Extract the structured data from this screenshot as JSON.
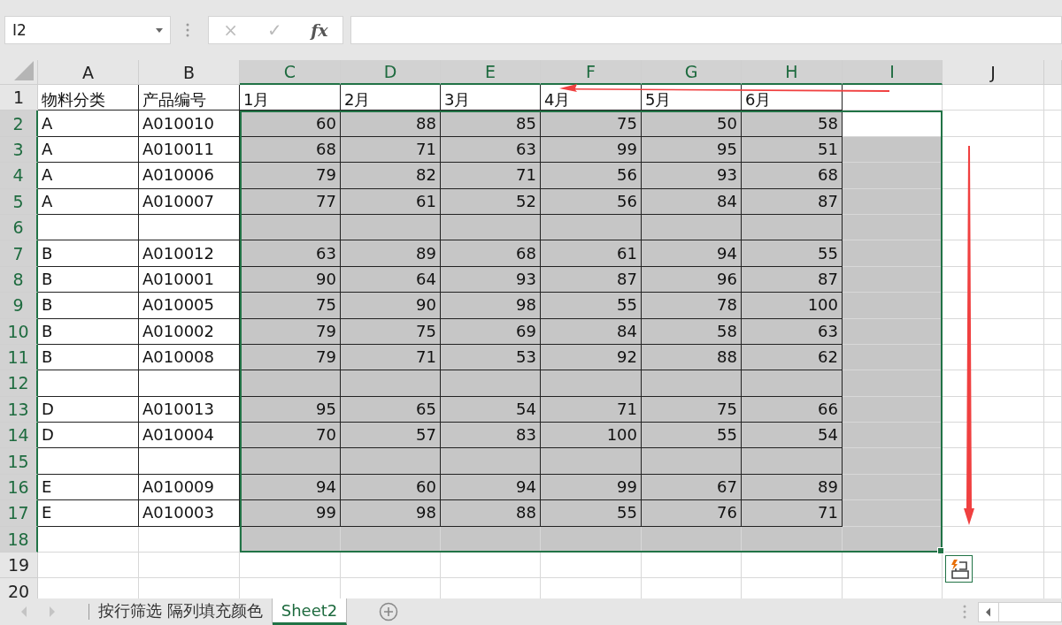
{
  "name_box": {
    "value": "I2"
  },
  "formula_bar": {
    "cancel": "×",
    "enter": "✓",
    "function": "fx"
  },
  "columns": [
    {
      "letter": "A",
      "selected": false,
      "active": false
    },
    {
      "letter": "B",
      "selected": false,
      "active": false
    },
    {
      "letter": "C",
      "selected": true,
      "active": false
    },
    {
      "letter": "D",
      "selected": true,
      "active": false
    },
    {
      "letter": "E",
      "selected": true,
      "active": false
    },
    {
      "letter": "F",
      "selected": true,
      "active": false
    },
    {
      "letter": "G",
      "selected": true,
      "active": false
    },
    {
      "letter": "H",
      "selected": true,
      "active": false
    },
    {
      "letter": "I",
      "selected": true,
      "active": true
    },
    {
      "letter": "J",
      "selected": false,
      "active": false
    }
  ],
  "rows": [
    {
      "number": "1",
      "kind": "header",
      "selected": false,
      "active": false,
      "category": "物料分类",
      "code": "产品编号",
      "values": [
        "1月",
        "2月",
        "3月",
        "4月",
        "5月",
        "6月"
      ]
    },
    {
      "number": "2",
      "kind": "data",
      "selected": true,
      "active": true,
      "category": "A",
      "code": "A010010",
      "values": [
        "60",
        "88",
        "85",
        "75",
        "50",
        "58"
      ]
    },
    {
      "number": "3",
      "kind": "data",
      "selected": true,
      "active": false,
      "category": "A",
      "code": "A010011",
      "values": [
        "68",
        "71",
        "63",
        "99",
        "95",
        "51"
      ]
    },
    {
      "number": "4",
      "kind": "data",
      "selected": true,
      "active": false,
      "category": "A",
      "code": "A010006",
      "values": [
        "79",
        "82",
        "71",
        "56",
        "93",
        "68"
      ]
    },
    {
      "number": "5",
      "kind": "data",
      "selected": true,
      "active": false,
      "category": "A",
      "code": "A010007",
      "values": [
        "77",
        "61",
        "52",
        "56",
        "84",
        "87"
      ]
    },
    {
      "number": "6",
      "kind": "data",
      "selected": true,
      "active": false
    },
    {
      "number": "7",
      "kind": "data",
      "selected": true,
      "active": false,
      "category": "B",
      "code": "A010012",
      "values": [
        "63",
        "89",
        "68",
        "61",
        "94",
        "55"
      ]
    },
    {
      "number": "8",
      "kind": "data",
      "selected": true,
      "active": false,
      "category": "B",
      "code": "A010001",
      "values": [
        "90",
        "64",
        "93",
        "87",
        "96",
        "87"
      ]
    },
    {
      "number": "9",
      "kind": "data",
      "selected": true,
      "active": false,
      "category": "B",
      "code": "A010005",
      "values": [
        "75",
        "90",
        "98",
        "55",
        "78",
        "100"
      ]
    },
    {
      "number": "10",
      "kind": "data",
      "selected": true,
      "active": false,
      "category": "B",
      "code": "A010002",
      "values": [
        "79",
        "75",
        "69",
        "84",
        "58",
        "63"
      ]
    },
    {
      "number": "11",
      "kind": "data",
      "selected": true,
      "active": false,
      "category": "B",
      "code": "A010008",
      "values": [
        "79",
        "71",
        "53",
        "92",
        "88",
        "62"
      ]
    },
    {
      "number": "12",
      "kind": "data",
      "selected": true,
      "active": false
    },
    {
      "number": "13",
      "kind": "data",
      "selected": true,
      "active": false,
      "category": "D",
      "code": "A010013",
      "values": [
        "95",
        "65",
        "54",
        "71",
        "75",
        "66"
      ]
    },
    {
      "number": "14",
      "kind": "data",
      "selected": true,
      "active": false,
      "category": "D",
      "code": "A010004",
      "values": [
        "70",
        "57",
        "83",
        "100",
        "55",
        "54"
      ]
    },
    {
      "number": "15",
      "kind": "data",
      "selected": true,
      "active": false
    },
    {
      "number": "16",
      "kind": "data",
      "selected": true,
      "active": false,
      "category": "E",
      "code": "A010009",
      "values": [
        "94",
        "60",
        "94",
        "99",
        "67",
        "89"
      ]
    },
    {
      "number": "17",
      "kind": "data",
      "selected": true,
      "active": false,
      "category": "E",
      "code": "A010003",
      "values": [
        "99",
        "98",
        "88",
        "55",
        "76",
        "71"
      ]
    },
    {
      "number": "18",
      "kind": "plain",
      "selected": true,
      "active": false
    },
    {
      "number": "19",
      "kind": "plain",
      "selected": false,
      "active": false
    },
    {
      "number": "20",
      "kind": "plain",
      "selected": false,
      "active": false
    }
  ],
  "sheet_tabs": [
    {
      "label": "按行筛选 隔列填充颜色",
      "selected": false
    },
    {
      "label": "Sheet2",
      "selected": true
    }
  ]
}
